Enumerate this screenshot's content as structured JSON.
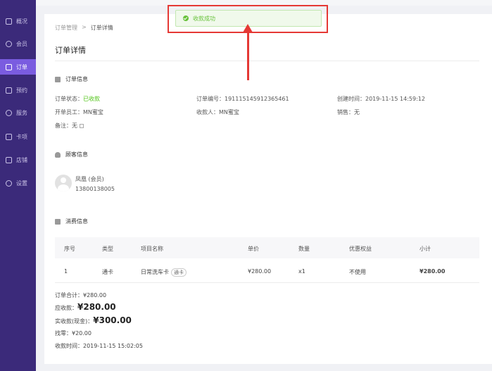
{
  "sidebar": {
    "items": [
      {
        "label": "概况",
        "icon": "chat-icon"
      },
      {
        "label": "会员",
        "icon": "diamond-icon"
      },
      {
        "label": "订单",
        "icon": "order-icon"
      },
      {
        "label": "预约",
        "icon": "calendar-icon"
      },
      {
        "label": "服务",
        "icon": "service-icon"
      },
      {
        "label": "卡项",
        "icon": "card-icon"
      },
      {
        "label": "店铺",
        "icon": "store-icon"
      },
      {
        "label": "设置",
        "icon": "gear-icon"
      }
    ],
    "active_index": 2,
    "bg_color": "#3b2a7a",
    "active_color": "#7a5ce0"
  },
  "breadcrumb": {
    "parent": "订单管理",
    "separator": ">",
    "current": "订单详情"
  },
  "page_title": "订单详情",
  "order_info": {
    "section_title": "订单信息",
    "status_label": "订单状态：",
    "status_value": "已收款",
    "order_no": "订单编号：191115145912365461",
    "created": "创建时间：2019-11-15 14:59:12",
    "staff": "开单员工：MN蜜宝",
    "cashier": "收款人：MN蜜宝",
    "sales": "销售：无",
    "remark": "备注：无"
  },
  "customer_info": {
    "section_title": "顾客信息",
    "name": "凤凰 (会员)",
    "phone": "13800138005"
  },
  "consumption": {
    "section_title": "消费信息",
    "columns": [
      "序号",
      "类型",
      "项目名称",
      "单价",
      "数量",
      "优惠权益",
      "小计"
    ],
    "rows": [
      {
        "no": "1",
        "type": "通卡",
        "item": "日常洗车卡",
        "tag": "通卡",
        "price": "¥280.00",
        "qty": "x1",
        "discount": "不使用",
        "subtotal": "¥280.00"
      }
    ]
  },
  "summary": {
    "order_total": "订单合计：¥280.00",
    "due_label": "应收款：",
    "due_value": "¥280.00",
    "paid_label": "实收款(现金)：",
    "paid_value": "¥300.00",
    "change": "找零：¥20.00",
    "paid_time": "收款时间：2019-11-15 15:02:05"
  },
  "toast": {
    "message": "收款成功",
    "type": "success"
  }
}
